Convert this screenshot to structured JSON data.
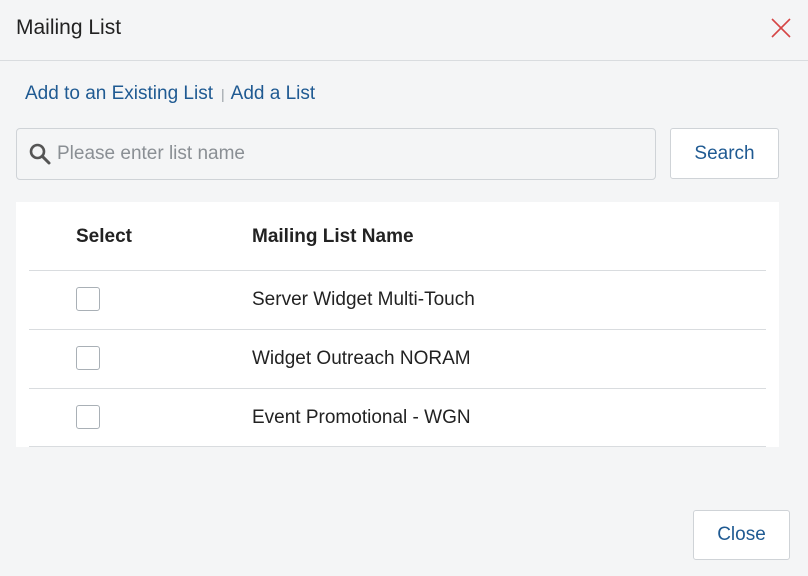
{
  "dialog": {
    "title": "Mailing List",
    "close_icon": "close-icon"
  },
  "links": {
    "existing": "Add to an Existing List",
    "separator": "|",
    "add": "Add a List"
  },
  "search": {
    "placeholder": "Please enter list name",
    "value": "",
    "button_label": "Search",
    "icon": "search-icon"
  },
  "table": {
    "headers": [
      "Select",
      "Mailing List Name"
    ],
    "rows": [
      {
        "name": "Server Widget Multi-Touch",
        "checked": false
      },
      {
        "name": "Widget Outreach NORAM",
        "checked": false
      },
      {
        "name": "Event Promotional - WGN",
        "checked": false
      }
    ]
  },
  "footer": {
    "close_label": "Close"
  },
  "colors": {
    "link": "#1f5a92",
    "close_icon": "#d64545",
    "background": "#f4f5f6"
  }
}
